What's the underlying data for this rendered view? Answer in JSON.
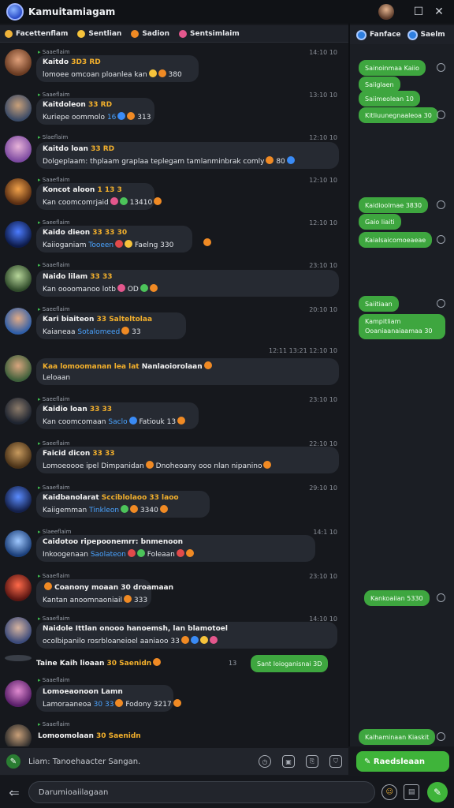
{
  "window": {
    "title": "Kamuitamiagam"
  },
  "channels": [
    {
      "label": "Facettenflam",
      "color": "#f0b43a"
    },
    {
      "label": "Sentlian",
      "color": "#f6c33b"
    },
    {
      "label": "Sadion",
      "color": "#f08a24"
    },
    {
      "label": "Sentsimlaim",
      "color": "#e4578d"
    }
  ],
  "right_tabs": [
    {
      "label": "Fanface"
    },
    {
      "label": "Saelm"
    }
  ],
  "messages": [
    {
      "author": "Saaeflaim",
      "line1": "Kaitdo",
      "tag": "3D3 RD",
      "line2": "lomoee omcoan ploanlea kan",
      "highlight": "",
      "tail": "380",
      "time": "14:10 10",
      "emojis": [
        "y",
        "o"
      ]
    },
    {
      "author": "Saaeflaim",
      "line1": "Kaitdoleon",
      "tag": "33 RD",
      "line2": "Kuriepe oommolo",
      "highlight": "16",
      "tail": "313",
      "time": "13:10 10",
      "emojis": [
        "b",
        "o"
      ]
    },
    {
      "author": "Slaeflaim",
      "line1": "Kaitdo loan",
      "tag": "33 RD",
      "line2": "Dolgeplaam: thplaam graplaa teplegam tamlanminbrak comly",
      "highlight": "",
      "tail": "80",
      "time": "12:10 10",
      "emojis": [
        "o",
        "b"
      ]
    },
    {
      "author": "Saaeflaim",
      "line1": "Koncot aloon",
      "tag": "1 13 3",
      "line2": "Kan coomcomrjaid",
      "highlight": "",
      "tail": "13410",
      "time": "12:10 10",
      "emojis": [
        "p",
        "g",
        "o"
      ]
    },
    {
      "author": "Saeeflaim",
      "line1": "Kaido dieon",
      "tag": "33 33 30",
      "line2": "Kaiioganiam",
      "highlight": "Tooeen",
      "tail": "Faelng 330",
      "time": "12:10 10",
      "emojis": [
        "r",
        "y",
        "o"
      ]
    },
    {
      "author": "Saaeflaim",
      "line1": "Naido lilam",
      "tag": "33 33",
      "line2": "Kan oooomanoo lotb",
      "highlight": "",
      "tail": "OD",
      "time": "23:10 10",
      "emojis": [
        "p",
        "g",
        "o"
      ]
    },
    {
      "author": "Saeeflaim",
      "line1": "Kari biaiteon",
      "tag": "33 Salteltolaa",
      "line2": "Kaianeaa",
      "highlight": "Sotalomeed",
      "tail": "33",
      "time": "20:10 10",
      "emojis": [
        "o"
      ]
    },
    {
      "author": "",
      "line1": "Kaa lomoomanan lea lat",
      "tag": "Nanlaoiorolaan",
      "line2": "Leloaan",
      "highlight": "",
      "tail": "",
      "time": "12:11 13:21 12:10 10",
      "emojis": [
        "o"
      ]
    },
    {
      "author": "Saeeflaim",
      "line1": "Kaidio loan",
      "tag": "33 33",
      "line2": "Kan coomcomaan",
      "highlight": "Saclo",
      "tail": "Fatiouk 13",
      "time": "23:10 10",
      "emojis": [
        "b",
        "o"
      ]
    },
    {
      "author": "Saeeflaim",
      "line1": "Faicid dicon",
      "tag": "33 33",
      "line2": "Lomoeoooe ipel Dimpanidan",
      "highlight": "",
      "tail": "Dnoheoany ooo nlan nipanino",
      "time": "22:10 10",
      "emojis": [
        "o"
      ]
    },
    {
      "author": "Saaeflaim",
      "line1": "Kaidbanolarat",
      "tag": "Scciblolaoo 33 laoo",
      "line2": "Kaiigemman",
      "highlight": "Tinkleon",
      "tail": "3340",
      "time": "29:10 10",
      "emojis": [
        "g",
        "o",
        "o"
      ]
    },
    {
      "author": "Slaeeflaim",
      "line1": "Caidotoo ripepoonemrr: bnmenoon",
      "tag": "",
      "line2": "Inkoogenaan",
      "highlight": "Saolateon",
      "tail": "Foleaan",
      "time": "14:1 10",
      "emojis": [
        "r",
        "g",
        "r",
        "o"
      ]
    },
    {
      "author": "Saaeflaim",
      "line1": "Coanony moaan",
      "tag": "30 droamaan",
      "line2": "Kantan anoomnaoniail",
      "highlight": "",
      "tail": "333",
      "time": "23:10 10",
      "emojis": [
        "o"
      ]
    },
    {
      "author": "Saaeflaim",
      "line1": "Naidole Ittlan onooo hanoemsh, lan blamotoel",
      "tag": "",
      "line2": "ocolbipanilo rosrbloaneioel aaniaoo",
      "highlight": "",
      "tail": "33",
      "time": "14:10 10",
      "emojis": [
        "o",
        "b",
        "y",
        "p"
      ]
    },
    {
      "author": "",
      "line1": "Taine Kaih lioaan",
      "tag": "30 Saenidn",
      "line2": "",
      "highlight": "",
      "tail": "",
      "time": "",
      "emojis": [
        "o"
      ]
    },
    {
      "author": "Saaeflaim",
      "line1": "Lomoeaonoon Lamn",
      "tag": "",
      "line2": "Lamoraaneoa",
      "highlight": "30 33",
      "tail": "Fodony 3217",
      "time": "",
      "emojis": [
        "o",
        "o"
      ]
    },
    {
      "author": "Saaeflaim",
      "line1": "Lomoomolaan",
      "tag": "30 Saenidn",
      "line2": "",
      "highlight": "",
      "tail": "",
      "time": "",
      "emojis": []
    }
  ],
  "inline_green": {
    "label": "Sant loioganisnai 3D",
    "side": "13"
  },
  "replies": [
    {
      "label": "Sainoinmaa Kaiio",
      "side": true
    },
    {
      "label": "Saiiglaen",
      "side": false
    },
    {
      "label": "Saiimeolean 10",
      "side": false
    },
    {
      "label": "Kitliuunegnaaleoa 30",
      "side": true
    },
    {
      "label": "Kaidioolmae 3830",
      "side": false
    },
    {
      "label": "Gaio liaiti",
      "side": false
    },
    {
      "label": "Kaialsaicomoeaeae",
      "side": true
    },
    {
      "label": "Saiitiaan",
      "side": true
    },
    {
      "label": "Kampitliam Ooaniaanaiaamaa 30",
      "side": false
    },
    {
      "label": "Kankoaiian 5330",
      "side": true
    },
    {
      "label": "Kalhaminaan Kiaskit",
      "side": true
    }
  ],
  "composer": {
    "placeholder": "Liam: Tanoehaacter Sangan.",
    "send_label": "Raedsleaan"
  },
  "bottom": {
    "search_placeholder": "Darumioaiilagaan"
  },
  "colors": {
    "accent": "#3fb43a",
    "bubble": "#262a32",
    "background": "#16181d"
  }
}
